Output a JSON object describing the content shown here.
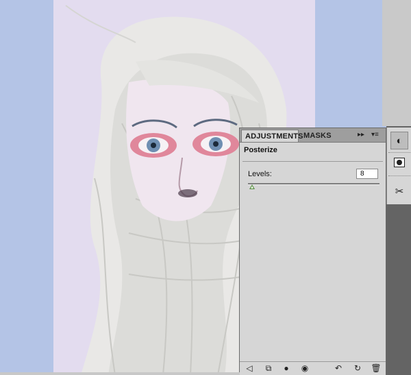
{
  "panel": {
    "tabs": [
      {
        "label": "ADJUSTMENTS",
        "active": true
      },
      {
        "label": "MASKS",
        "active": false
      }
    ],
    "tab_controls": {
      "expand_icon": "double-arrow-right-icon",
      "menu_icon": "panel-menu-icon"
    },
    "title": "Posterize",
    "levels_label": "Levels:",
    "levels_value": "8",
    "levels_slider_fraction": 0.03,
    "bottom_icons": [
      "back-arrow-icon",
      "clip-to-layer-icon",
      "layer-mask-icon",
      "visibility-eye-icon",
      "view-previous-state-icon",
      "reset-icon",
      "delete-icon"
    ]
  },
  "dock": {
    "icons": [
      "adjustments-icon",
      "masks-icon",
      "tools-icon"
    ]
  },
  "colors": {
    "canvas_bg": "#b4c4e6",
    "panel_bg": "#d6d6d6",
    "tabbar_bg": "#9e9e9e",
    "dock_dark": "#646464",
    "slider_thumb": "#5a8f45"
  }
}
